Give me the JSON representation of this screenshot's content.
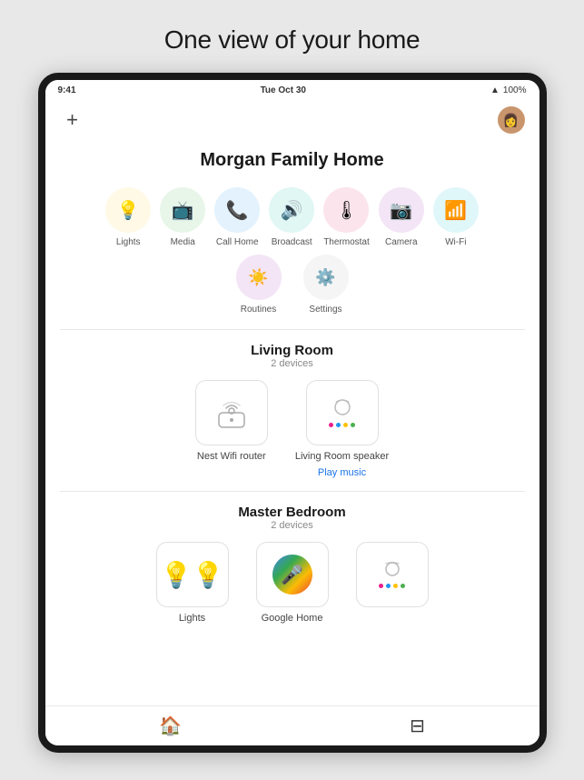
{
  "page": {
    "title": "One view of your home",
    "home_name": "Morgan Family Home",
    "status_bar": {
      "time": "9:41",
      "date": "Tue Oct 30",
      "wifi": "WiFi",
      "battery": "100%"
    }
  },
  "quick_actions": [
    {
      "id": "lights",
      "label": "Lights",
      "icon": "💡",
      "bg": "bg-yellow"
    },
    {
      "id": "media",
      "label": "Media",
      "icon": "📺",
      "bg": "bg-green"
    },
    {
      "id": "call-home",
      "label": "Call Home",
      "icon": "📞",
      "bg": "bg-blue"
    },
    {
      "id": "broadcast",
      "label": "Broadcast",
      "icon": "🔊",
      "bg": "bg-teal"
    },
    {
      "id": "thermostat",
      "label": "Thermostat",
      "icon": "🌡",
      "bg": "bg-red"
    },
    {
      "id": "camera",
      "label": "Camera",
      "icon": "📷",
      "bg": "bg-purple"
    },
    {
      "id": "wifi",
      "label": "Wi-Fi",
      "icon": "📶",
      "bg": "bg-cyan"
    }
  ],
  "utility_actions": [
    {
      "id": "routines",
      "label": "Routines",
      "icon": "☀"
    },
    {
      "id": "settings",
      "label": "Settings",
      "icon": "⚙"
    }
  ],
  "rooms": [
    {
      "id": "living-room",
      "name": "Living Room",
      "device_count": "2 devices",
      "devices": [
        {
          "id": "nest-wifi",
          "label": "Nest Wifi router",
          "action": null
        },
        {
          "id": "living-room-speaker",
          "label": "Living Room speaker",
          "action": "Play music"
        }
      ]
    },
    {
      "id": "master-bedroom",
      "name": "Master Bedroom",
      "device_count": "2 devices",
      "devices": [
        {
          "id": "lights-bedroom",
          "label": "Lights",
          "action": null
        },
        {
          "id": "google-home",
          "label": "Google Home",
          "action": null
        },
        {
          "id": "bedroom-speaker",
          "label": "",
          "action": null
        }
      ]
    }
  ],
  "nav": {
    "home_label": "🏠",
    "menu_label": "☰",
    "active": "home"
  },
  "add_button_label": "+",
  "avatar_emoji": "👩"
}
